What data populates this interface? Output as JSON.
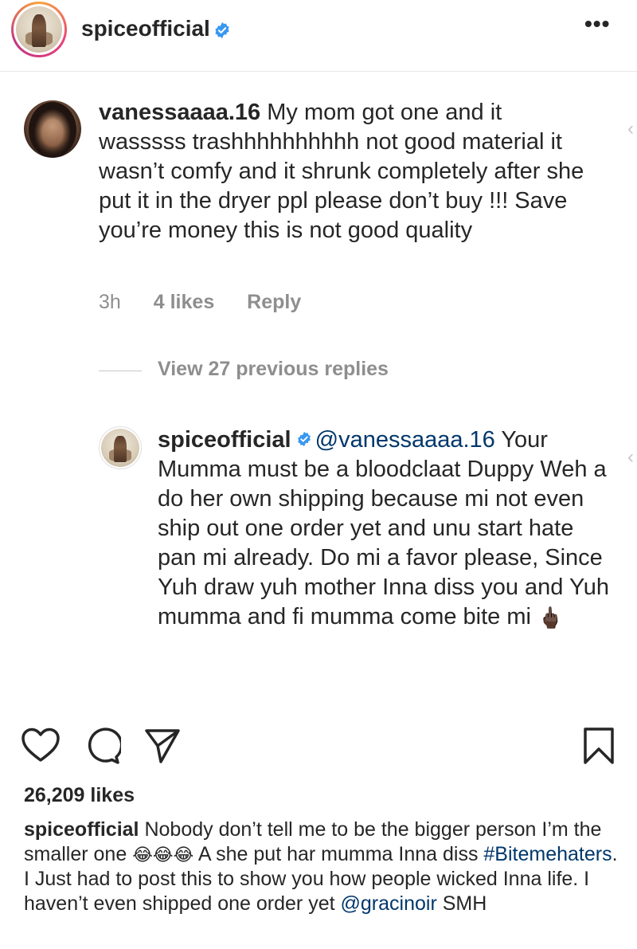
{
  "post": {
    "username": "spiceofficial",
    "verified_icon": "verified-badge-icon",
    "more_icon": "more-options-icon",
    "more_label": "•••"
  },
  "comment": {
    "username": "vanessaaaa.16",
    "text": "My mom got one and it wasssss trashhhhhhhhhh not good material it wasn’t comfy and it shrunk completely after she put it in the dryer ppl please don’t buy !!! Save you’re money this is not good quality",
    "time": "3h",
    "likes": "4 likes",
    "reply_label": "Reply"
  },
  "view_replies": "View 27 previous replies",
  "reply": {
    "username": "spiceofficial",
    "mention": "@vanessaaaa.16",
    "text": "Your Mumma must be a bloodclaat Duppy Weh a do her own shipping because mi not even ship out one order yet and unu start hate pan mi already.  Do mi a favor please, Since Yuh draw yuh mother Inna diss you and Yuh mumma and fi mumma come bite mi",
    "emoji": "🖕🏿"
  },
  "actions": {
    "like_icon": "heart-icon",
    "comment_icon": "comment-icon",
    "share_icon": "share-icon",
    "save_icon": "bookmark-icon"
  },
  "likes": "26,209 likes",
  "caption": {
    "username": "spiceofficial",
    "text_1": "Nobody don’t tell me to be the bigger person I’m the smaller one",
    "emojis": "😂😂😂",
    "text_2": "A she put har mumma Inna diss",
    "hashtag": "#Bitemehaters",
    "text_3": ".  I Just had to post this to show you how people wicked Inna life. I haven’t even shipped one order yet",
    "mention": "@gracinoir",
    "text_4": "SMH"
  },
  "colors": {
    "text": "#262626",
    "secondary": "#8e8e8e",
    "link": "#00376b",
    "verified": "#3897f0"
  }
}
